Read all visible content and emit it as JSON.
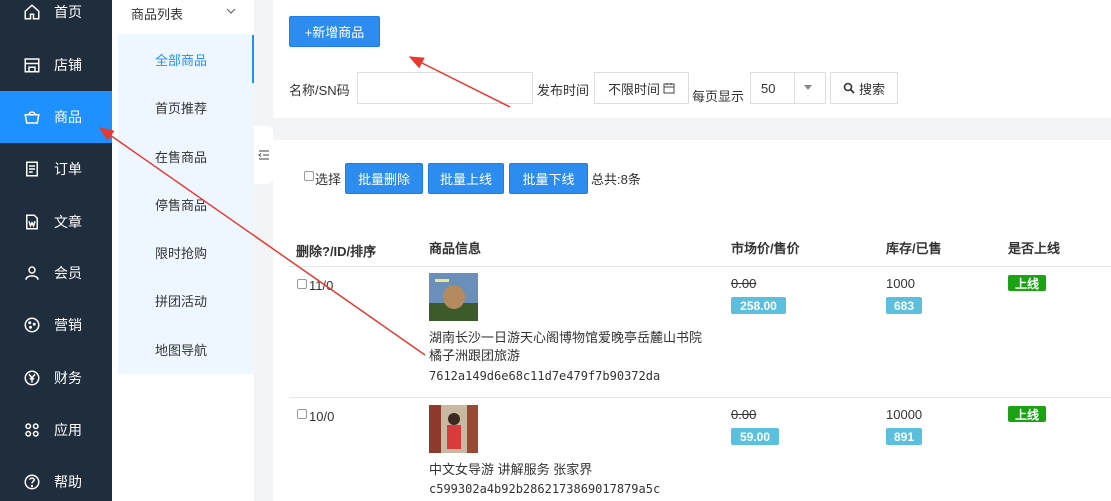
{
  "nav": {
    "items": [
      {
        "label": "首页",
        "icon": "home-icon"
      },
      {
        "label": "店铺",
        "icon": "store-icon"
      },
      {
        "label": "商品",
        "icon": "basket-icon",
        "active": true
      },
      {
        "label": "订单",
        "icon": "document-icon"
      },
      {
        "label": "文章",
        "icon": "word-file-icon"
      },
      {
        "label": "会员",
        "icon": "user-icon"
      },
      {
        "label": "营销",
        "icon": "cookie-icon"
      },
      {
        "label": "财务",
        "icon": "yen-icon"
      },
      {
        "label": "应用",
        "icon": "apps-icon"
      },
      {
        "label": "帮助",
        "icon": "help-icon"
      }
    ]
  },
  "submenu": {
    "header": "商品列表",
    "items": [
      {
        "label": "全部商品",
        "active": true
      },
      {
        "label": "首页推荐"
      },
      {
        "label": "在售商品"
      },
      {
        "label": "停售商品"
      },
      {
        "label": "限时抢购"
      },
      {
        "label": "拼团活动"
      },
      {
        "label": "地图导航"
      }
    ]
  },
  "toolbar": {
    "add_button": "+新增商品"
  },
  "filters": {
    "name_label": "名称/SN码",
    "name_value": "",
    "time_label": "发布时间",
    "time_value": "不限时间",
    "per_page_label": "每页显示",
    "per_page_value": "50",
    "search_button": "搜索"
  },
  "bulk": {
    "select_label": "选择",
    "delete_button": "批量删除",
    "online_button": "批量上线",
    "offline_button": "批量下线",
    "total": "总共:8条"
  },
  "table": {
    "headers": [
      "删除?/ID/排序",
      "商品信息",
      "市场价/售价",
      "库存/已售",
      "是否上线"
    ],
    "rows": [
      {
        "id_sort": "11/0",
        "title_line1": "湖南长沙一日游天心阁博物馆爱晚亭岳麓山书院",
        "title_line2": "橘子洲跟团旅游",
        "sn": "7612a149d6e68c11d7e479f7b90372da",
        "market_price": "0.00",
        "price": "258.00",
        "stock": "1000",
        "sold": "683",
        "status": "上线"
      },
      {
        "id_sort": "10/0",
        "title_line1": "中文女导游 讲解服务 张家界",
        "title_line2": "",
        "sn": "c599302a4b92b2862173869017879a5c",
        "market_price": "0.00",
        "price": "59.00",
        "stock": "10000",
        "sold": "891",
        "status": "上线"
      }
    ]
  },
  "colors": {
    "nav_bg": "#1f2d3d",
    "accent": "#2d8cf0",
    "badge_blue": "#5bc0de",
    "badge_green": "#1ba314",
    "annotation_arrow": "#e8392f"
  }
}
